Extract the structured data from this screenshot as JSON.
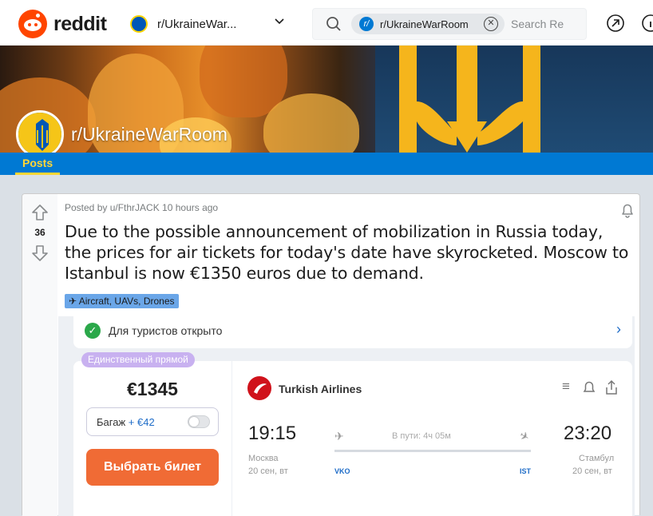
{
  "header": {
    "logo_text": "reddit",
    "community_selector": "r/UkraineWar...",
    "search_chip": "r/UkraineWarRoom",
    "search_placeholder": "Search Reddit"
  },
  "banner": {
    "subreddit_title": "r/UkraineWarRoom"
  },
  "nav": {
    "posts_tab": "Posts"
  },
  "post": {
    "score": "36",
    "meta": "Posted by u/FthrJACK 10 hours ago",
    "title": "Due to the possible announcement of mobilization in Russia today, the prices for air tickets for today's date have skyrocketed. Moscow to Istanbul is now €1350 euros due to demand.",
    "flair": "✈ Aircraft, UAVs, Drones"
  },
  "embedded": {
    "tour_text": "Для туристов открыто",
    "badge": "Единственный прямой",
    "price": "€1345",
    "bag_label": "Багаж",
    "bag_price": "+ €42",
    "buy_button": "Выбрать билет",
    "airline": "Turkish Airlines",
    "depart_time": "19:15",
    "arrive_time": "23:20",
    "duration": "В пути: 4ч 05м",
    "depart_city": "Москва",
    "arrive_city": "Стамбул",
    "depart_date": "20 сен, вт",
    "arrive_date": "20 сен, вт",
    "depart_code": "VKO",
    "arrive_code": "IST"
  },
  "colors": {
    "reddit_orange": "#ff4500",
    "nav_blue": "#0079d3",
    "tab_yellow": "#ffd635",
    "buy_orange": "#f06b35"
  }
}
